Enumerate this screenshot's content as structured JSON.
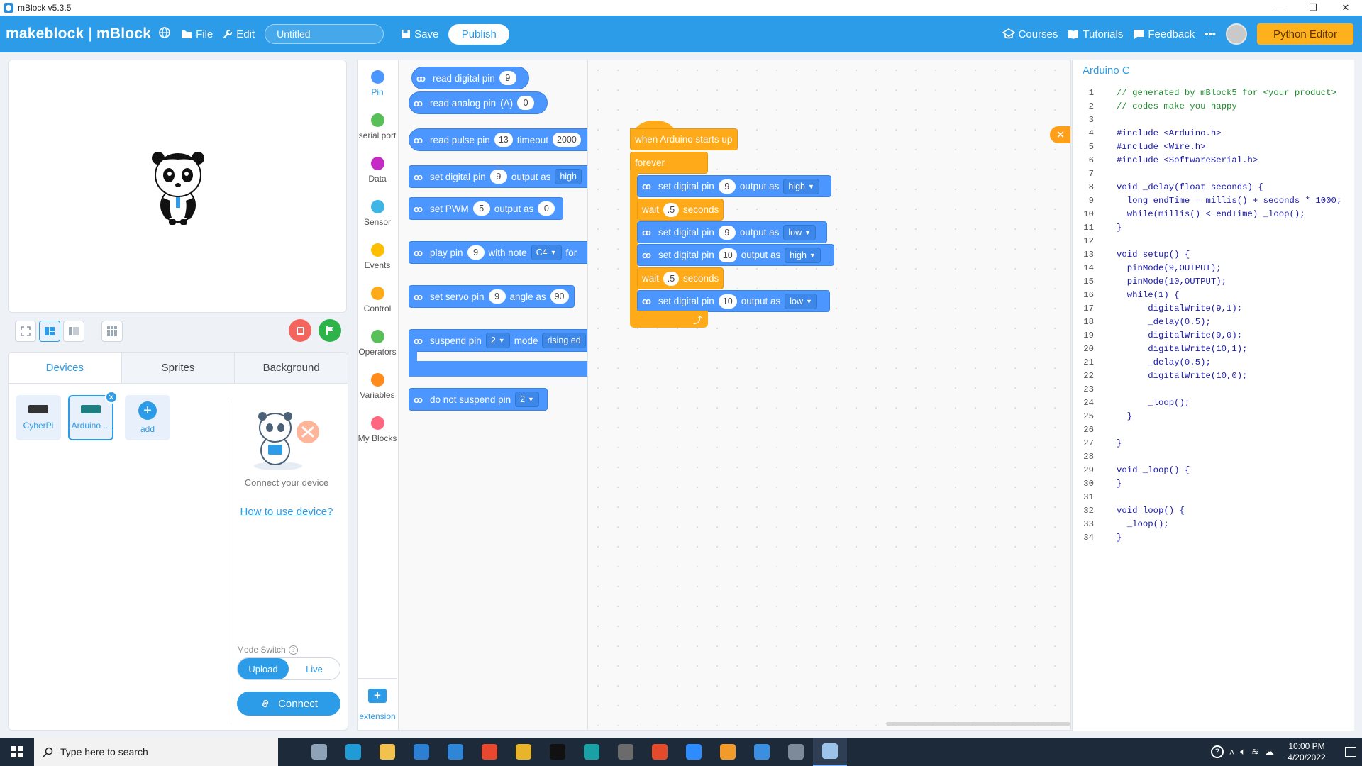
{
  "window": {
    "title": "mBlock v5.3.5",
    "controls": [
      "—",
      "❐",
      "✕"
    ]
  },
  "menubar": {
    "brand_left": "makeblock",
    "brand_sep": "|",
    "brand_right": "mBlock",
    "file": "File",
    "edit": "Edit",
    "project_name": "Untitled",
    "save": "Save",
    "publish": "Publish",
    "courses": "Courses",
    "tutorials": "Tutorials",
    "feedback": "Feedback",
    "more": "•••",
    "python_editor": "Python Editor"
  },
  "device_panel": {
    "tabs": [
      "Devices",
      "Sprites",
      "Background"
    ],
    "devices": [
      {
        "label": "CyberPi"
      },
      {
        "label": "Arduino ..."
      }
    ],
    "add_label": "add",
    "connect_text": "Connect your device",
    "howto_link": "How to use device?",
    "mode_switch_label": "Mode Switch",
    "modes": [
      "Upload",
      "Live"
    ],
    "active_mode": "Upload",
    "connect_button": "Connect"
  },
  "categories": [
    {
      "label": "Pin",
      "color": "#4c97ff"
    },
    {
      "label": "serial port",
      "color": "#59c059"
    },
    {
      "label": "Data",
      "color": "#c42bc4"
    },
    {
      "label": "Sensor",
      "color": "#3fb6e3"
    },
    {
      "label": "Events",
      "color": "#ffbf00"
    },
    {
      "label": "Control",
      "color": "#ffab19"
    },
    {
      "label": "Operators",
      "color": "#59c059"
    },
    {
      "label": "Variables",
      "color": "#ff8c1a"
    },
    {
      "label": "My Blocks",
      "color": "#ff6680"
    }
  ],
  "extension_label": "extension",
  "palette": {
    "b1": {
      "text": "read digital pin",
      "pin": "9"
    },
    "b2": {
      "text": "read analog pin",
      "suffix": "(A)",
      "pin": "0"
    },
    "b3": {
      "text": "read pulse pin",
      "pin": "13",
      "mid": "timeout",
      "timeout": "2000"
    },
    "b4": {
      "text": "set digital pin",
      "pin": "9",
      "mid": "output as",
      "value": "high"
    },
    "b5": {
      "text": "set PWM",
      "pin": "5",
      "mid": "output as",
      "value": "0"
    },
    "b6": {
      "text": "play pin",
      "pin": "9",
      "mid": "with note",
      "note": "C4",
      "tail": "for"
    },
    "b7": {
      "text": "set servo pin",
      "pin": "9",
      "mid": "angle as",
      "value": "90"
    },
    "b8": {
      "text": "suspend pin",
      "pin": "2",
      "mid": "mode",
      "mode": "rising ed"
    },
    "b9": {
      "text": "do not suspend pin",
      "pin": "2"
    }
  },
  "script": {
    "hat": "when Arduino starts up",
    "forever": "forever",
    "s1": {
      "text": "set digital pin",
      "pin": "9",
      "mid": "output as",
      "value": "high"
    },
    "w1": {
      "text": "wait",
      "value": ".5",
      "unit": "seconds"
    },
    "s2": {
      "text": "set digital pin",
      "pin": "9",
      "mid": "output as",
      "value": "low"
    },
    "s3": {
      "text": "set digital pin",
      "pin": "10",
      "mid": "output as",
      "value": "high"
    },
    "w2": {
      "text": "wait",
      "value": ".5",
      "unit": "seconds"
    },
    "s4": {
      "text": "set digital pin",
      "pin": "10",
      "mid": "output as",
      "value": "low"
    }
  },
  "code_panel": {
    "title": "Arduino C",
    "lines": [
      "// generated by mBlock5 for <your product>",
      "// codes make you happy",
      "",
      "#include <Arduino.h>",
      "#include <Wire.h>",
      "#include <SoftwareSerial.h>",
      "",
      "void _delay(float seconds) {",
      "  long endTime = millis() + seconds * 1000;",
      "  while(millis() < endTime) _loop();",
      "}",
      "",
      "void setup() {",
      "  pinMode(9,OUTPUT);",
      "  pinMode(10,OUTPUT);",
      "  while(1) {",
      "      digitalWrite(9,1);",
      "      _delay(0.5);",
      "      digitalWrite(9,0);",
      "      digitalWrite(10,1);",
      "      _delay(0.5);",
      "      digitalWrite(10,0);",
      "",
      "      _loop();",
      "  }",
      "",
      "}",
      "",
      "void _loop() {",
      "}",
      "",
      "void loop() {",
      "  _loop();",
      "}"
    ]
  },
  "taskbar": {
    "search_placeholder": "Type here to search",
    "time": "10:00 PM",
    "date": "4/20/2022",
    "apps": [
      {
        "name": "mblock-pet-icon",
        "color": "#8fa3b8"
      },
      {
        "name": "edge-icon",
        "color": "#1f9bd8"
      },
      {
        "name": "file-explorer-icon",
        "color": "#f2c14e"
      },
      {
        "name": "store-icon",
        "color": "#2d7fd3"
      },
      {
        "name": "mail-icon",
        "color": "#2f86d6"
      },
      {
        "name": "office-icon",
        "color": "#e8492e"
      },
      {
        "name": "chrome-icon",
        "color": "#e7b42a"
      },
      {
        "name": "terminal-icon",
        "color": "#111111"
      },
      {
        "name": "arduino-icon",
        "color": "#1aa1a6"
      },
      {
        "name": "calculator-icon",
        "color": "#6b6b6b"
      },
      {
        "name": "pen-icon",
        "color": "#e54b2a"
      },
      {
        "name": "zoom-icon",
        "color": "#2d8cff"
      },
      {
        "name": "media-icon",
        "color": "#f29b2a"
      },
      {
        "name": "code-editor-icon",
        "color": "#3b8fe0"
      },
      {
        "name": "tools-icon",
        "color": "#7c8a99"
      },
      {
        "name": "mblock-icon",
        "color": "#9cc4ea"
      }
    ]
  }
}
